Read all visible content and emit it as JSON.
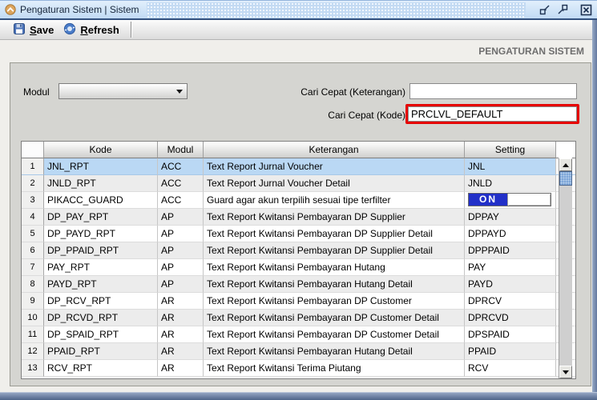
{
  "window": {
    "title": "Pengaturan Sistem | Sistem"
  },
  "toolbar": {
    "save_label": "Save",
    "refresh_label": "Refresh"
  },
  "page": {
    "heading": "PENGATURAN SISTEM"
  },
  "form": {
    "modul_label": "Modul",
    "modul_value": "",
    "cari_keterangan_label": "Cari Cepat (Keterangan)",
    "cari_keterangan_value": "",
    "cari_kode_label": "Cari Cepat (Kode)",
    "cari_kode_value": "PRCLVL_DEFAULT"
  },
  "table": {
    "columns": [
      "",
      "Kode",
      "Modul",
      "Keterangan",
      "Setting"
    ],
    "rows": [
      {
        "num": 1,
        "kode": "JNL_RPT",
        "modul": "ACC",
        "keterangan": "Text Report Jurnal Voucher",
        "setting": "JNL",
        "selected": true
      },
      {
        "num": 2,
        "kode": "JNLD_RPT",
        "modul": "ACC",
        "keterangan": "Text Report Jurnal Voucher Detail",
        "setting": "JNLD"
      },
      {
        "num": 3,
        "kode": "PIKACC_GUARD",
        "modul": "ACC",
        "keterangan": "Guard agar akun terpilih sesuai tipe terfilter",
        "setting": "",
        "toggle": "ON"
      },
      {
        "num": 4,
        "kode": "DP_PAY_RPT",
        "modul": "AP",
        "keterangan": "Text Report Kwitansi Pembayaran DP Supplier",
        "setting": "DPPAY"
      },
      {
        "num": 5,
        "kode": "DP_PAYD_RPT",
        "modul": "AP",
        "keterangan": "Text Report Kwitansi Pembayaran DP Supplier Detail",
        "setting": "DPPAYD"
      },
      {
        "num": 6,
        "kode": "DP_PPAID_RPT",
        "modul": "AP",
        "keterangan": "Text Report Kwitansi Pembayaran DP Supplier Detail",
        "setting": "DPPPAID"
      },
      {
        "num": 7,
        "kode": "PAY_RPT",
        "modul": "AP",
        "keterangan": "Text Report Kwitansi Pembayaran Hutang",
        "setting": "PAY"
      },
      {
        "num": 8,
        "kode": "PAYD_RPT",
        "modul": "AP",
        "keterangan": "Text Report Kwitansi Pembayaran Hutang Detail",
        "setting": "PAYD"
      },
      {
        "num": 9,
        "kode": "DP_RCV_RPT",
        "modul": "AR",
        "keterangan": "Text Report Kwitansi Pembayaran DP Customer",
        "setting": "DPRCV"
      },
      {
        "num": 10,
        "kode": "DP_RCVD_RPT",
        "modul": "AR",
        "keterangan": "Text Report Kwitansi Pembayaran DP Customer Detail",
        "setting": "DPRCVD"
      },
      {
        "num": 11,
        "kode": "DP_SPAID_RPT",
        "modul": "AR",
        "keterangan": "Text Report Kwitansi Pembayaran DP Customer Detail",
        "setting": "DPSPAID"
      },
      {
        "num": 12,
        "kode": "PPAID_RPT",
        "modul": "AR",
        "keterangan": "Text Report Kwitansi Pembayaran Hutang Detail",
        "setting": "PPAID"
      },
      {
        "num": 13,
        "kode": "RCV_RPT",
        "modul": "AR",
        "keterangan": "Text Report Kwitansi Terima Piutang",
        "setting": "RCV"
      }
    ]
  },
  "icons": {
    "titlebar_app": "chevron-up-circle-icon",
    "toolbar_save": "floppy-disk-icon",
    "toolbar_refresh": "refresh-circle-icon",
    "window_float": "float-window-icon",
    "window_maximize": "maximize-window-icon",
    "window_close": "close-window-icon",
    "modul_dropdown": "chevron-down-icon",
    "scroll_up": "triangle-up-icon",
    "scroll_down": "triangle-down-icon"
  },
  "colors": {
    "titlebar_bg": "#cfe3f8",
    "selected_row_bg": "#bad8f4",
    "highlight_border": "#e60000",
    "toggle_on_bg": "#2230c8",
    "heading_text": "#6e6e6e",
    "window_edge": "#63789e"
  }
}
